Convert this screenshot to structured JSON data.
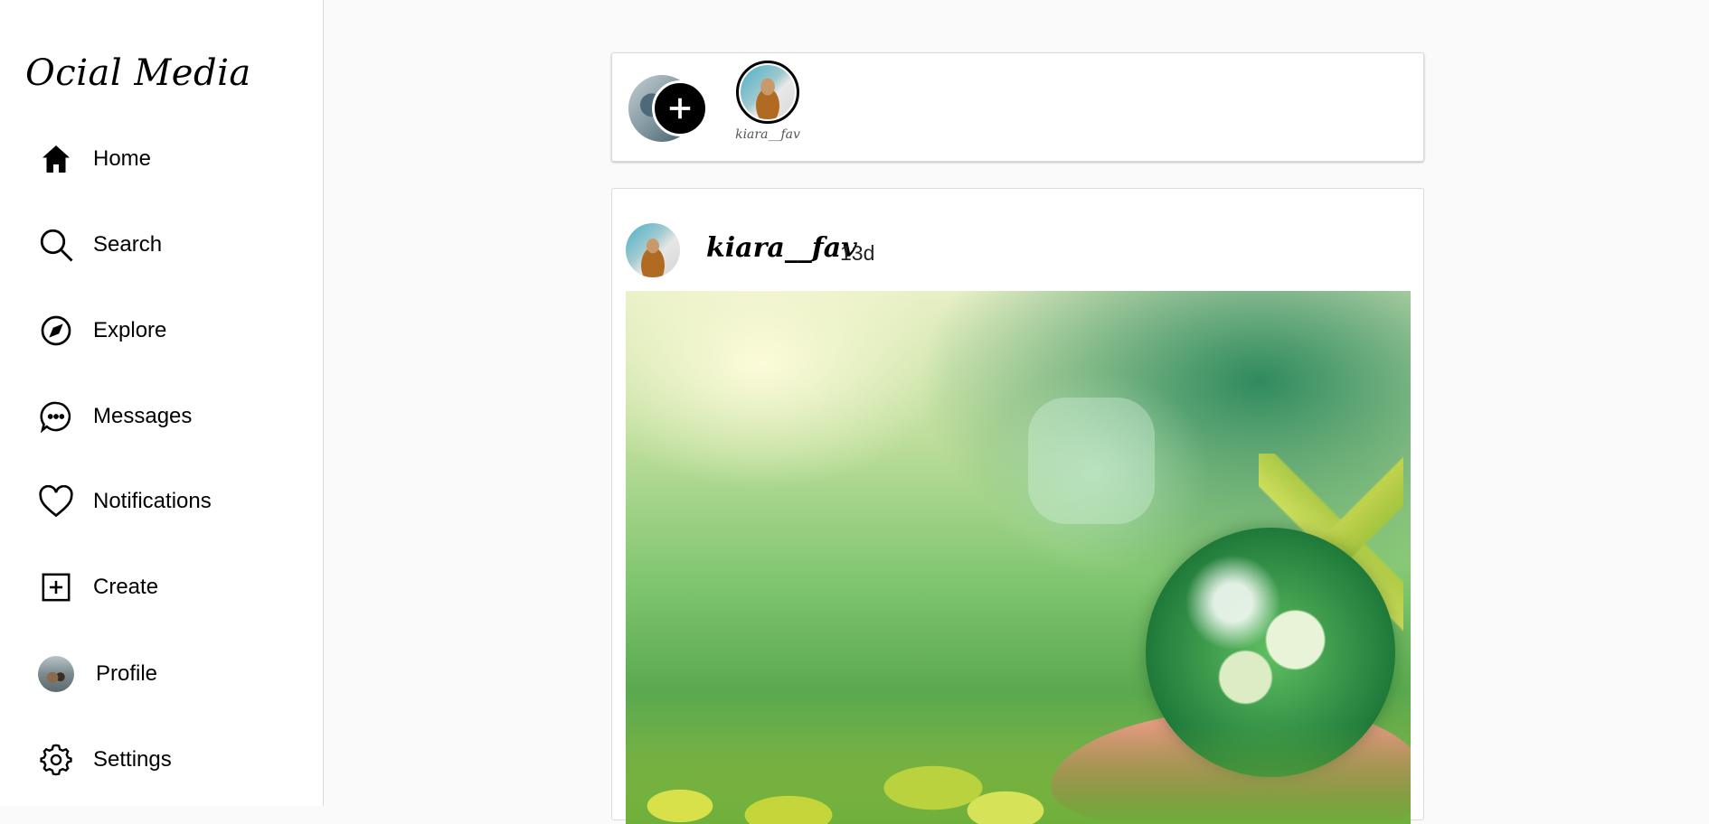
{
  "sidebar": {
    "brand": "Ocial Media",
    "items": [
      {
        "label": "Home",
        "icon": "home-icon"
      },
      {
        "label": "Search",
        "icon": "search-icon"
      },
      {
        "label": "Explore",
        "icon": "compass-icon"
      },
      {
        "label": "Messages",
        "icon": "message-icon"
      },
      {
        "label": "Notifications",
        "icon": "heart-icon"
      },
      {
        "label": "Create",
        "icon": "plus-square-icon"
      },
      {
        "label": "Profile",
        "icon": "avatar"
      },
      {
        "label": "Settings",
        "icon": "gear-icon"
      }
    ]
  },
  "stories": {
    "items": [
      {
        "username": "kiara__fav"
      }
    ]
  },
  "post": {
    "username": "kiara__fav",
    "time": "13d"
  }
}
